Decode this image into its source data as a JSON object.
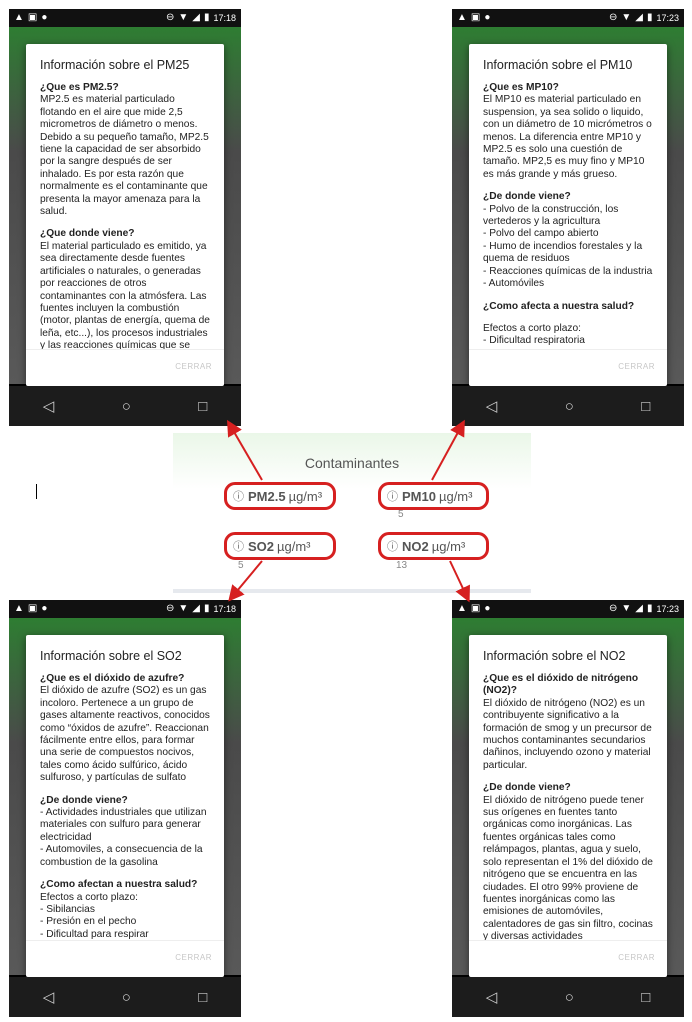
{
  "status_bar": {
    "time_left": "17:18",
    "time_right": "17:23"
  },
  "close_label": "CERRAR",
  "dialogs": {
    "pm25": {
      "title": "Información sobre el PM25",
      "sections": [
        {
          "heading": "¿Que es PM2.5?",
          "text": "MP2.5 es material particulado flotando en el aire que mide 2,5 micrometros de diámetro o menos. Debido a su pequeño tamaño, MP2.5 tiene la capacidad de ser absorbido por la sangre después de ser inhalado. Es por esta razón que normalmente es el contaminante que presenta la mayor amenaza para la salud."
        },
        {
          "heading": "¿Que donde viene?",
          "text": "El material particulado es emitido, ya sea directamente desde fuentes artificiales o naturales, o generadas por reacciones de otros contaminantes con la atmósfera. Las fuentes incluyen la combustión (motor, plantas de energía, quema de leña, etc...), los procesos industriales y las reacciones químicas que se producen entre gases tales como"
        }
      ]
    },
    "pm10": {
      "title": "Información sobre el PM10",
      "sections": [
        {
          "heading": "¿Que es MP10?",
          "text": "El MP10 es material particulado en suspension, ya sea solido o liquido, con un diámetro de 10 micrómetros o menos. La diferencia entre MP10 y MP2.5 es solo una cuestión de tamaño. MP2,5 es muy fino y MP10 es más grande y más grueso."
        },
        {
          "heading": "¿De donde viene?",
          "text": "- Polvo de la construcción, los vertederos y la agricultura\n- Polvo del campo abierto\n- Humo de incendios forestales y la quema de residuos\n- Reacciones químicas de la industria\n- Automóviles"
        },
        {
          "heading": "¿Como afecta a nuestra salud?",
          "text": ""
        },
        {
          "heading": "",
          "text": "Efectos a corto plazo:\n- Dificultad respiratoria"
        }
      ]
    },
    "so2": {
      "title": "Información sobre el SO2",
      "sections": [
        {
          "heading": "¿Que es el dióxido de azufre?",
          "text": "El dióxido de azufre (SO2) es un gas incoloro. Pertenece a un grupo de gases altamente reactivos, conocidos como “óxidos de azufre”. Reaccionan fácilmente entre ellos, para formar una serie de compuestos nocivos, tales como ácido sulfúrico, ácido sulfuroso, y partículas de sulfato"
        },
        {
          "heading": "¿De donde viene?",
          "text": "- Actividades industriales que utilizan materiales con sulfuro para generar electricidad\n- Automoviles, a consecuencia de la combustion de la gasolina"
        },
        {
          "heading": "¿Como afectan a nuestra salud?",
          "text": "Efectos a corto plazo:\n- Sibilancias\n- Presión en el pecho\n- Dificultad para respirar"
        }
      ]
    },
    "no2": {
      "title": "Información sobre el NO2",
      "sections": [
        {
          "heading": "¿Que es el dióxido de nitrógeno (NO2)?",
          "text": "El dióxido de nitrógeno (NO2) es un contribuyente significativo a la formación de smog y un precursor de muchos contaminantes secundarios dañinos, incluyendo ozono y material particular."
        },
        {
          "heading": "¿De donde viene?",
          "text": "El dióxido de nitrógeno puede tener sus orígenes en fuentes tanto orgánicas como inorgánicas. Las fuentes orgánicas tales como relámpagos, plantas, agua y suelo, solo representan el 1% del dióxido de nitrógeno que se encuentra en las ciudades. El otro 99% proviene de fuentes inorgánicas como las emisiones de automóviles, calentadores de gas sin filtro, cocinas y diversas actividades"
        }
      ]
    }
  },
  "contaminantes": {
    "title": "Contaminantes",
    "items": [
      {
        "name": "PM2.5",
        "unit": "µg/m³",
        "value": "",
        "bold": true
      },
      {
        "name": "PM10",
        "unit": "µg/m³",
        "value": "5"
      },
      {
        "name": "SO2",
        "unit": "µg/m³",
        "value": "5"
      },
      {
        "name": "NO2",
        "unit": "µg/m³",
        "value": "13"
      }
    ]
  },
  "colors": {
    "highlight": "#d62020",
    "app_green": "#2e7d32"
  },
  "icons": [
    "warning-icon",
    "image-icon",
    "record-icon",
    "minus-circle-icon",
    "wifi-icon",
    "signal-icon",
    "battery-icon",
    "info-icon",
    "back-icon",
    "home-icon",
    "recents-icon"
  ]
}
